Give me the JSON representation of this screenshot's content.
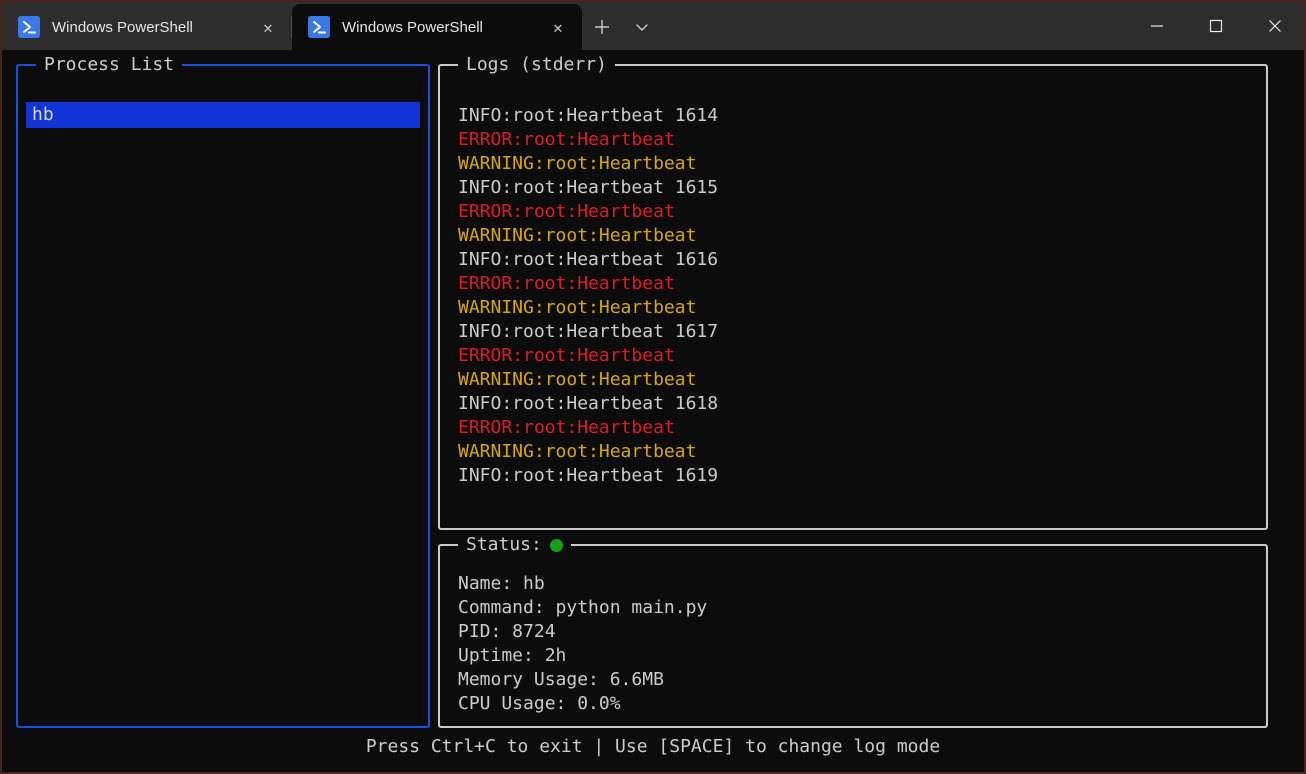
{
  "window": {
    "border_color": "#4a2318",
    "titlebar_bg": "#2d2d2d",
    "terminal_bg": "#0c0c0c"
  },
  "titlebar": {
    "tabs": [
      {
        "title": "Windows PowerShell",
        "icon": "powershell-icon",
        "active": false,
        "close_label": "✕"
      },
      {
        "title": "Windows PowerShell",
        "icon": "powershell-icon",
        "active": true,
        "close_label": "✕"
      }
    ],
    "new_tab_label": "+",
    "dropdown_label": "⌄",
    "controls": {
      "minimize_label": "—",
      "maximize_label": "□",
      "close_label": "✕"
    }
  },
  "process_list": {
    "title": "Process List",
    "border_color": "#1a4fe0",
    "selected_bg": "#1233d6",
    "items": [
      {
        "label": "hb",
        "selected": true
      }
    ]
  },
  "logs": {
    "title": "Logs (stderr)",
    "border_color": "#cccccc",
    "colors": {
      "info": "#cccccc",
      "error": "#e01b24",
      "warning": "#d8a800"
    },
    "lines": [
      {
        "level": "info",
        "text": "INFO:root:Heartbeat 1614"
      },
      {
        "level": "error",
        "text": "ERROR:root:Heartbeat"
      },
      {
        "level": "warning",
        "text": "WARNING:root:Heartbeat"
      },
      {
        "level": "info",
        "text": "INFO:root:Heartbeat 1615"
      },
      {
        "level": "error",
        "text": "ERROR:root:Heartbeat"
      },
      {
        "level": "warning",
        "text": "WARNING:root:Heartbeat"
      },
      {
        "level": "info",
        "text": "INFO:root:Heartbeat 1616"
      },
      {
        "level": "error",
        "text": "ERROR:root:Heartbeat"
      },
      {
        "level": "warning",
        "text": "WARNING:root:Heartbeat"
      },
      {
        "level": "info",
        "text": "INFO:root:Heartbeat 1617"
      },
      {
        "level": "error",
        "text": "ERROR:root:Heartbeat"
      },
      {
        "level": "warning",
        "text": "WARNING:root:Heartbeat"
      },
      {
        "level": "info",
        "text": "INFO:root:Heartbeat 1618"
      },
      {
        "level": "error",
        "text": "ERROR:root:Heartbeat"
      },
      {
        "level": "warning",
        "text": "WARNING:root:Heartbeat"
      },
      {
        "level": "info",
        "text": "INFO:root:Heartbeat 1619"
      }
    ]
  },
  "status": {
    "title": "Status:",
    "indicator": "running-dot",
    "indicator_color": "#16a016",
    "lines": [
      "Name: hb",
      "Command: python main.py",
      "PID: 8724",
      "Uptime: 2h",
      "Memory Usage: 6.6MB",
      "CPU Usage: 0.0%"
    ]
  },
  "footer": {
    "hint": "Press Ctrl+C to exit | Use [SPACE] to change log mode"
  }
}
